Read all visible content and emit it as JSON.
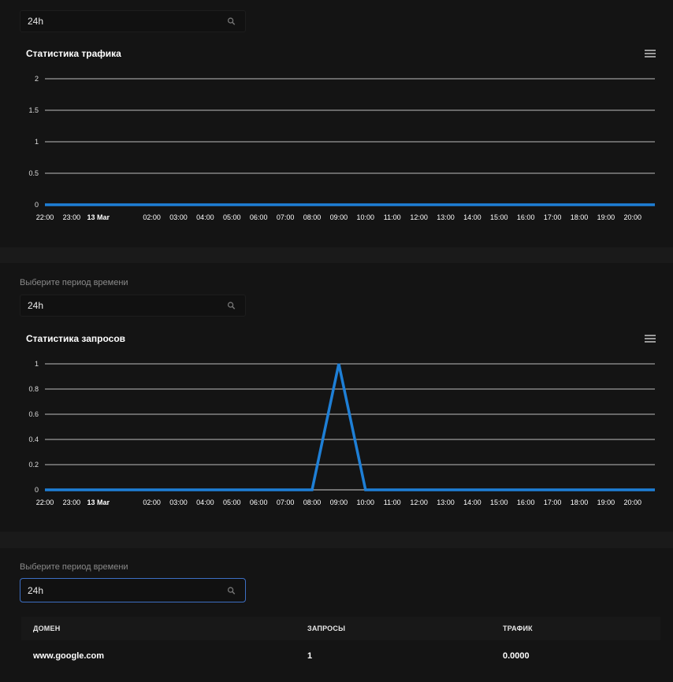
{
  "panels": [
    {
      "select_value": "24h",
      "chart_data": {
        "type": "line",
        "title": "Статистика трафика",
        "y_ticks": [
          "2",
          "1.5",
          "1",
          "0.5",
          "0"
        ],
        "ylim": [
          0,
          2
        ],
        "x_ticks": [
          "22:00",
          "23:00",
          "13 Mar",
          "02:00",
          "03:00",
          "04:00",
          "05:00",
          "06:00",
          "07:00",
          "08:00",
          "09:00",
          "10:00",
          "11:00",
          "12:00",
          "13:00",
          "14:00",
          "15:00",
          "16:00",
          "17:00",
          "18:00",
          "19:00",
          "20:00"
        ],
        "series": [
          {
            "x": [
              "22:00",
              "20:00"
            ],
            "y": [
              0,
              0
            ]
          }
        ],
        "grid": true,
        "color": "#1e7fd6"
      }
    },
    {
      "period_label": "Выберите период времени",
      "select_value": "24h",
      "chart_data": {
        "type": "line",
        "title": "Статистика запросов",
        "y_ticks": [
          "1",
          "0.8",
          "0.6",
          "0.4",
          "0.2",
          "0"
        ],
        "ylim": [
          0,
          1
        ],
        "x_ticks": [
          "22:00",
          "23:00",
          "13 Mar",
          "02:00",
          "03:00",
          "04:00",
          "05:00",
          "06:00",
          "07:00",
          "08:00",
          "09:00",
          "10:00",
          "11:00",
          "12:00",
          "13:00",
          "14:00",
          "15:00",
          "16:00",
          "17:00",
          "18:00",
          "19:00",
          "20:00"
        ],
        "series": [
          {
            "x": [
              "22:00",
              "08:00",
              "09:00",
              "10:00",
              "20:00"
            ],
            "y": [
              0,
              0,
              1,
              0,
              0
            ]
          }
        ],
        "grid": true,
        "color": "#1e7fd6"
      }
    }
  ],
  "table_section": {
    "period_label": "Выберите период времени",
    "select_value": "24h",
    "columns": [
      "ДОМЕН",
      "ЗАПРОСЫ",
      "ТРАФИК"
    ],
    "rows": [
      [
        "www.google.com",
        "1",
        "0.0000"
      ]
    ]
  }
}
